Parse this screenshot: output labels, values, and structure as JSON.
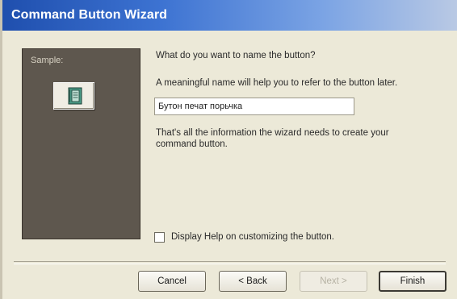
{
  "window": {
    "title": "Command Button Wizard"
  },
  "sample": {
    "label": "Sample:",
    "icon": "book-icon"
  },
  "content": {
    "question": "What do you want to name the button?",
    "hint": "A meaningful name will help you to refer to the button later.",
    "name_value": "Бутон печат порьчка",
    "info": "That's all the information the wizard needs to create your command button."
  },
  "help_checkbox": {
    "label": "Display Help on customizing the button.",
    "checked": false
  },
  "buttons": {
    "cancel": "Cancel",
    "back": "< Back",
    "next": "Next >",
    "finish": "Finish"
  }
}
